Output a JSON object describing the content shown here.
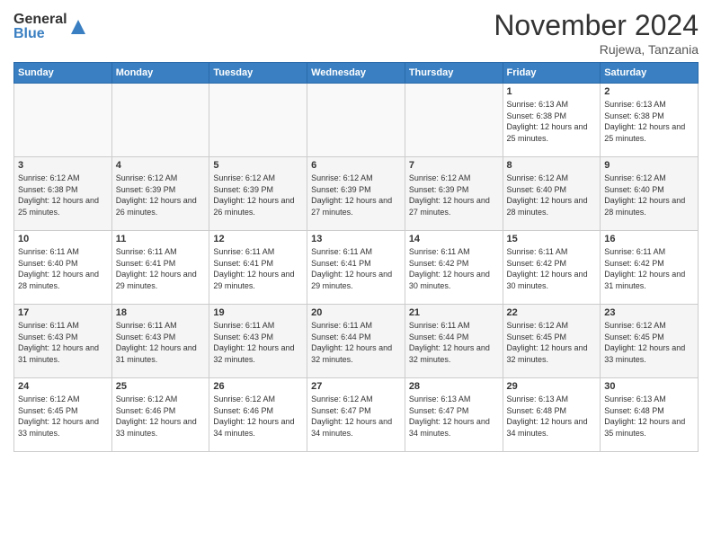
{
  "header": {
    "logo_general": "General",
    "logo_blue": "Blue",
    "title": "November 2024",
    "location": "Rujewa, Tanzania"
  },
  "days_of_week": [
    "Sunday",
    "Monday",
    "Tuesday",
    "Wednesday",
    "Thursday",
    "Friday",
    "Saturday"
  ],
  "weeks": [
    [
      {
        "day": "",
        "info": ""
      },
      {
        "day": "",
        "info": ""
      },
      {
        "day": "",
        "info": ""
      },
      {
        "day": "",
        "info": ""
      },
      {
        "day": "",
        "info": ""
      },
      {
        "day": "1",
        "info": "Sunrise: 6:13 AM\nSunset: 6:38 PM\nDaylight: 12 hours and 25 minutes."
      },
      {
        "day": "2",
        "info": "Sunrise: 6:13 AM\nSunset: 6:38 PM\nDaylight: 12 hours and 25 minutes."
      }
    ],
    [
      {
        "day": "3",
        "info": "Sunrise: 6:12 AM\nSunset: 6:38 PM\nDaylight: 12 hours and 25 minutes."
      },
      {
        "day": "4",
        "info": "Sunrise: 6:12 AM\nSunset: 6:39 PM\nDaylight: 12 hours and 26 minutes."
      },
      {
        "day": "5",
        "info": "Sunrise: 6:12 AM\nSunset: 6:39 PM\nDaylight: 12 hours and 26 minutes."
      },
      {
        "day": "6",
        "info": "Sunrise: 6:12 AM\nSunset: 6:39 PM\nDaylight: 12 hours and 27 minutes."
      },
      {
        "day": "7",
        "info": "Sunrise: 6:12 AM\nSunset: 6:39 PM\nDaylight: 12 hours and 27 minutes."
      },
      {
        "day": "8",
        "info": "Sunrise: 6:12 AM\nSunset: 6:40 PM\nDaylight: 12 hours and 28 minutes."
      },
      {
        "day": "9",
        "info": "Sunrise: 6:12 AM\nSunset: 6:40 PM\nDaylight: 12 hours and 28 minutes."
      }
    ],
    [
      {
        "day": "10",
        "info": "Sunrise: 6:11 AM\nSunset: 6:40 PM\nDaylight: 12 hours and 28 minutes."
      },
      {
        "day": "11",
        "info": "Sunrise: 6:11 AM\nSunset: 6:41 PM\nDaylight: 12 hours and 29 minutes."
      },
      {
        "day": "12",
        "info": "Sunrise: 6:11 AM\nSunset: 6:41 PM\nDaylight: 12 hours and 29 minutes."
      },
      {
        "day": "13",
        "info": "Sunrise: 6:11 AM\nSunset: 6:41 PM\nDaylight: 12 hours and 29 minutes."
      },
      {
        "day": "14",
        "info": "Sunrise: 6:11 AM\nSunset: 6:42 PM\nDaylight: 12 hours and 30 minutes."
      },
      {
        "day": "15",
        "info": "Sunrise: 6:11 AM\nSunset: 6:42 PM\nDaylight: 12 hours and 30 minutes."
      },
      {
        "day": "16",
        "info": "Sunrise: 6:11 AM\nSunset: 6:42 PM\nDaylight: 12 hours and 31 minutes."
      }
    ],
    [
      {
        "day": "17",
        "info": "Sunrise: 6:11 AM\nSunset: 6:43 PM\nDaylight: 12 hours and 31 minutes."
      },
      {
        "day": "18",
        "info": "Sunrise: 6:11 AM\nSunset: 6:43 PM\nDaylight: 12 hours and 31 minutes."
      },
      {
        "day": "19",
        "info": "Sunrise: 6:11 AM\nSunset: 6:43 PM\nDaylight: 12 hours and 32 minutes."
      },
      {
        "day": "20",
        "info": "Sunrise: 6:11 AM\nSunset: 6:44 PM\nDaylight: 12 hours and 32 minutes."
      },
      {
        "day": "21",
        "info": "Sunrise: 6:11 AM\nSunset: 6:44 PM\nDaylight: 12 hours and 32 minutes."
      },
      {
        "day": "22",
        "info": "Sunrise: 6:12 AM\nSunset: 6:45 PM\nDaylight: 12 hours and 32 minutes."
      },
      {
        "day": "23",
        "info": "Sunrise: 6:12 AM\nSunset: 6:45 PM\nDaylight: 12 hours and 33 minutes."
      }
    ],
    [
      {
        "day": "24",
        "info": "Sunrise: 6:12 AM\nSunset: 6:45 PM\nDaylight: 12 hours and 33 minutes."
      },
      {
        "day": "25",
        "info": "Sunrise: 6:12 AM\nSunset: 6:46 PM\nDaylight: 12 hours and 33 minutes."
      },
      {
        "day": "26",
        "info": "Sunrise: 6:12 AM\nSunset: 6:46 PM\nDaylight: 12 hours and 34 minutes."
      },
      {
        "day": "27",
        "info": "Sunrise: 6:12 AM\nSunset: 6:47 PM\nDaylight: 12 hours and 34 minutes."
      },
      {
        "day": "28",
        "info": "Sunrise: 6:13 AM\nSunset: 6:47 PM\nDaylight: 12 hours and 34 minutes."
      },
      {
        "day": "29",
        "info": "Sunrise: 6:13 AM\nSunset: 6:48 PM\nDaylight: 12 hours and 34 minutes."
      },
      {
        "day": "30",
        "info": "Sunrise: 6:13 AM\nSunset: 6:48 PM\nDaylight: 12 hours and 35 minutes."
      }
    ]
  ]
}
